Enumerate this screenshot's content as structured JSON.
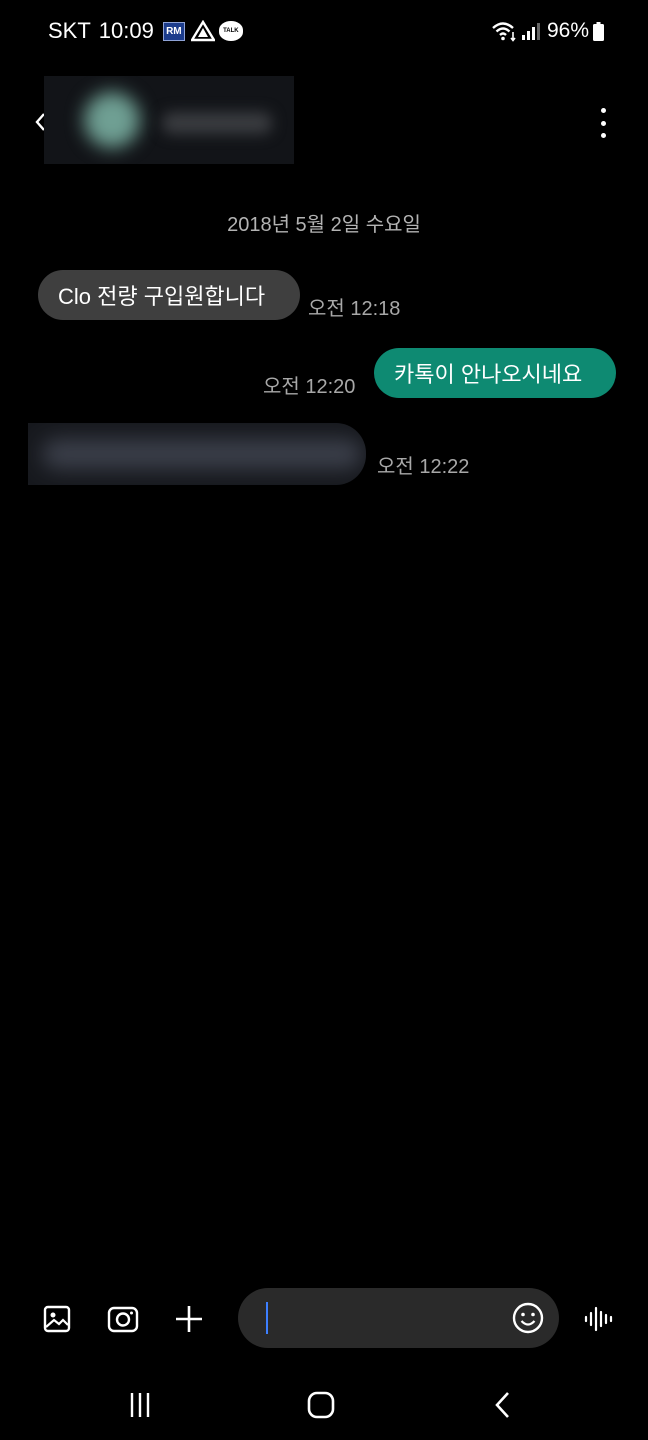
{
  "status_bar": {
    "carrier": "SKT",
    "time": "10:09",
    "notif_rm": "RM",
    "notif_talk": "TALK",
    "battery": "96%"
  },
  "conversation": {
    "date": "2018년 5월 2일 수요일",
    "messages": [
      {
        "direction": "incoming",
        "text": "Clo 전량 구입원합니다",
        "time": "오전 12:18"
      },
      {
        "direction": "outgoing",
        "text": "카톡이 안나오시네요",
        "time": "오전 12:20"
      },
      {
        "direction": "incoming",
        "text": "",
        "time": "오전 12:22"
      }
    ]
  },
  "composer": {
    "value": ""
  },
  "colors": {
    "outgoing_bubble": "#0e8a72",
    "incoming_bubble": "#3f3f3f",
    "cursor": "#3d7fff"
  },
  "icons": {
    "gallery": "gallery-icon",
    "camera": "camera-icon",
    "add": "plus-icon",
    "emoji": "emoji-icon",
    "voice": "voice-waveform-icon",
    "more": "more-vertical-icon"
  }
}
